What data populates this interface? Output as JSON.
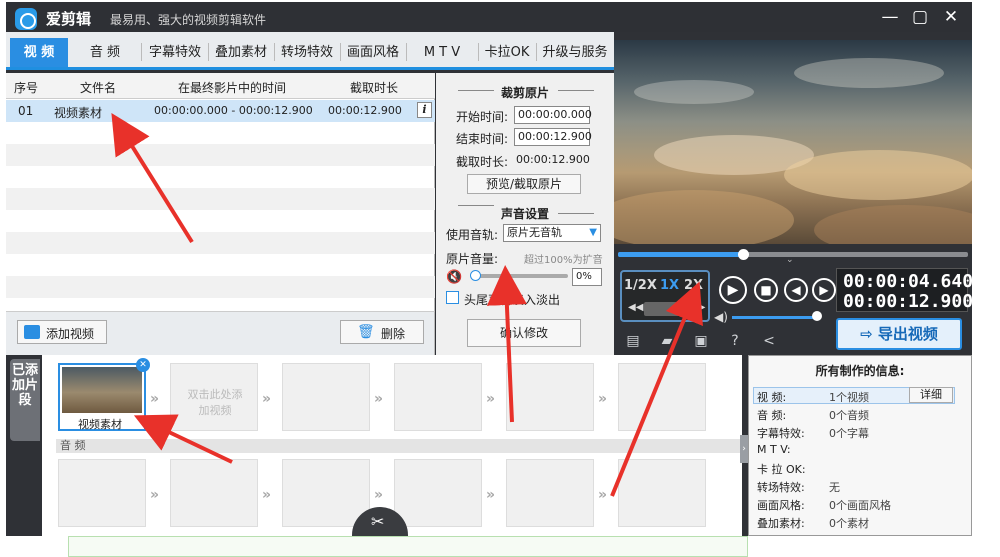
{
  "window": {
    "title": "爱剪辑",
    "subtitle": "最易用、强大的视频剪辑软件",
    "controls": {
      "minimize": "—",
      "maximize": "▢",
      "close": "✕"
    }
  },
  "tabs": [
    {
      "label": "视 频",
      "active": true
    },
    {
      "label": "音 频"
    },
    {
      "label": "字幕特效"
    },
    {
      "label": "叠加素材"
    },
    {
      "label": "转场特效"
    },
    {
      "label": "画面风格"
    },
    {
      "label": "M T V"
    },
    {
      "label": "卡拉OK"
    },
    {
      "label": "升级与服务"
    }
  ],
  "clip_table": {
    "headers": [
      "序号",
      "文件名",
      "在最终影片中的时间",
      "截取时长"
    ],
    "rows": [
      {
        "index": "01",
        "name": "视频素材",
        "range": "00:00:00.000 - 00:00:12.900",
        "duration": "00:00:12.900"
      }
    ],
    "info_icon": "i"
  },
  "left_buttons": {
    "add_video": "添加视频",
    "delete": "删除"
  },
  "trim": {
    "section_title": "裁剪原片",
    "start_label": "开始时间:",
    "start_value": "00:00:00.000",
    "end_label": "结束时间:",
    "end_value": "00:00:12.900",
    "duration_label": "截取时长:",
    "duration_value": "00:00:12.900",
    "preview_button": "预览/截取原片"
  },
  "audio": {
    "section_title": "声音设置",
    "track_label": "使用音轨:",
    "track_value": "原片无音轨",
    "volume_label": "原片音量:",
    "volume_hint": "超过100%为扩音",
    "volume_value": "0%",
    "fade_label": "头尾声音淡入淡出",
    "confirm_button": "确认修改"
  },
  "player": {
    "speeds": [
      "1/2X",
      "1X",
      "2X"
    ],
    "active_speed": "1X",
    "current_time": "00:00:04.640",
    "total_time": "00:00:12.900",
    "progress": 0.36,
    "export_button": "导出视频"
  },
  "timeline": {
    "added_tab": "已添加片段",
    "clip_label": "视频素材",
    "placeholder": "双击此处添加视频",
    "audio_label": "音 频"
  },
  "info_panel": {
    "title": "所有制作的信息:",
    "detail_button": "详细",
    "rows": [
      {
        "label": "视    频:",
        "value": "1个视频"
      },
      {
        "label": "音    频:",
        "value": "0个音频"
      },
      {
        "label": "字幕特效:",
        "value": "0个字幕"
      },
      {
        "label": "M  T  V:",
        "value": ""
      },
      {
        "label": "卡 拉 OK:",
        "value": ""
      },
      {
        "label": "转场特效:",
        "value": "无"
      },
      {
        "label": "画面风格:",
        "value": "0个画面风格"
      },
      {
        "label": "叠加素材:",
        "value": "0个素材"
      }
    ]
  },
  "colors": {
    "accent": "#2a8ee2",
    "annotation": "#e8312a",
    "dark": "#2f3136"
  }
}
